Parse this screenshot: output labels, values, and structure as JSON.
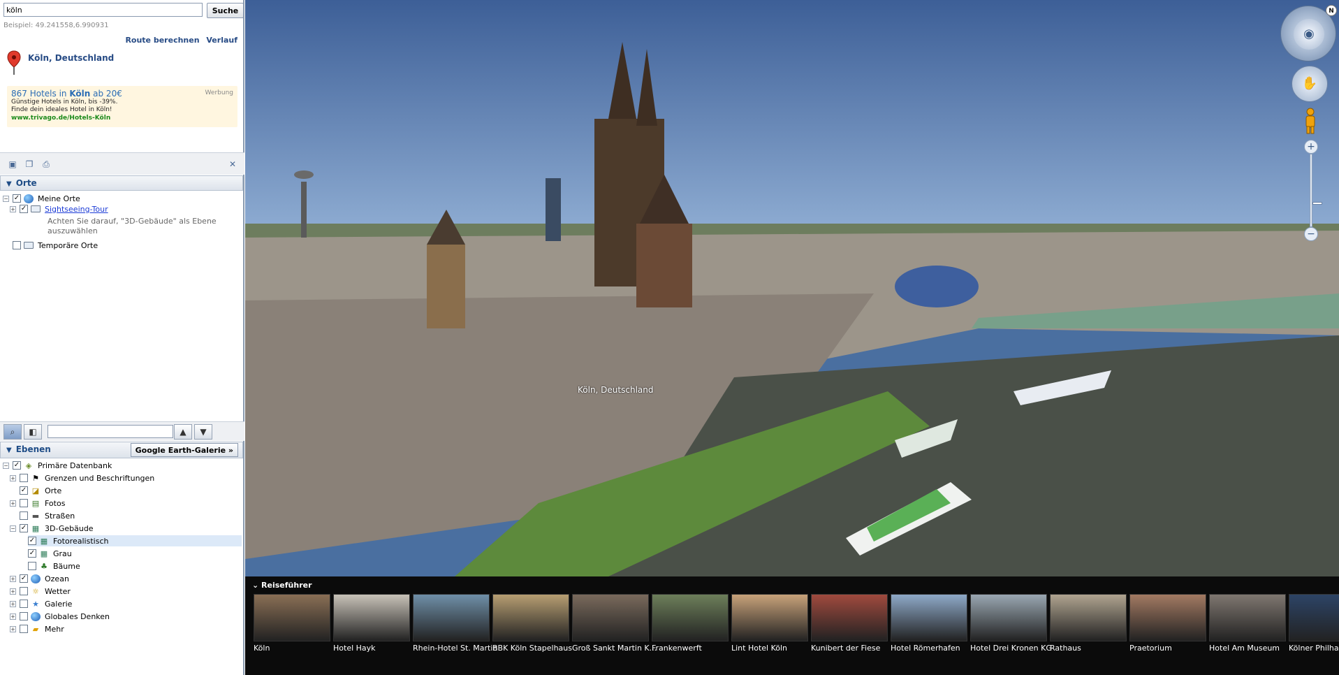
{
  "search": {
    "value": "köln",
    "button": "Suche",
    "example": "Beispiel: 49.241558,6.990931"
  },
  "links": {
    "route": "Route berechnen",
    "history": "Verlauf"
  },
  "result": {
    "title": "Köln, Deutschland"
  },
  "ad": {
    "title_pre": "867 Hotels in ",
    "title_bold": "Köln",
    "title_post": " ab 20€",
    "line1": "Günstige Hotels in Köln, bis -39%.",
    "line2": "Finde dein ideales Hotel in Köln!",
    "url": "www.trivago.de/Hotels-Köln",
    "label": "Werbung"
  },
  "orte": {
    "header": "Orte",
    "items": [
      {
        "label": "Meine Orte"
      },
      {
        "label": "Sightseeing-Tour"
      },
      {
        "label": "Temporäre Orte"
      }
    ],
    "note": "Achten Sie darauf, \"3D-Gebäude\" als Ebene auszuwählen"
  },
  "ebenen": {
    "header": "Ebenen",
    "gallery": "Google Earth-Galerie »",
    "items": [
      {
        "label": "Primäre Datenbank",
        "checked": true
      },
      {
        "label": "Grenzen und Beschriftungen",
        "checked": false
      },
      {
        "label": "Orte",
        "checked": true
      },
      {
        "label": "Fotos",
        "checked": false
      },
      {
        "label": "Straßen",
        "checked": false
      },
      {
        "label": "3D-Gebäude",
        "checked": true
      },
      {
        "label": "Fotorealistisch",
        "checked": true
      },
      {
        "label": "Grau",
        "checked": true
      },
      {
        "label": "Bäume",
        "checked": false
      },
      {
        "label": "Ozean",
        "checked": true
      },
      {
        "label": "Wetter",
        "checked": false
      },
      {
        "label": "Galerie",
        "checked": false
      },
      {
        "label": "Globales Denken",
        "checked": false
      },
      {
        "label": "Mehr",
        "checked": false
      }
    ]
  },
  "map": {
    "label": "Köln, Deutschland",
    "compass_n": "N"
  },
  "tour": {
    "title": "Reiseführer",
    "items": [
      {
        "label": "Köln",
        "color": "#8a6f55"
      },
      {
        "label": "Hotel Hayk",
        "color": "#c8c2b8"
      },
      {
        "label": "Rhein-Hotel St. Martin",
        "color": "#6f8fa8"
      },
      {
        "label": "BBK Köln Stapelhaus",
        "color": "#b79e72"
      },
      {
        "label": "Groß Sankt Martin K...",
        "color": "#7a6a5c"
      },
      {
        "label": "Frankenwerft",
        "color": "#6d7f5a"
      },
      {
        "label": "Lint Hotel Köln",
        "color": "#c8a27a"
      },
      {
        "label": "Kunibert der Fiese",
        "color": "#a04a3e"
      },
      {
        "label": "Hotel Römerhafen",
        "color": "#8ea9c8"
      },
      {
        "label": "Hotel Drei Kronen KG",
        "color": "#9aa7b2"
      },
      {
        "label": "Rathaus",
        "color": "#b0a490"
      },
      {
        "label": "Praetorium",
        "color": "#a37a62"
      },
      {
        "label": "Hotel Am Museum",
        "color": "#7f7770"
      },
      {
        "label": "Kölner Philhar",
        "color": "#2d4466"
      }
    ]
  },
  "colors": {
    "sidebar_link": "#274b85",
    "ad_bg": "#fff6e0",
    "tour_bg": "#0b0b0b"
  }
}
